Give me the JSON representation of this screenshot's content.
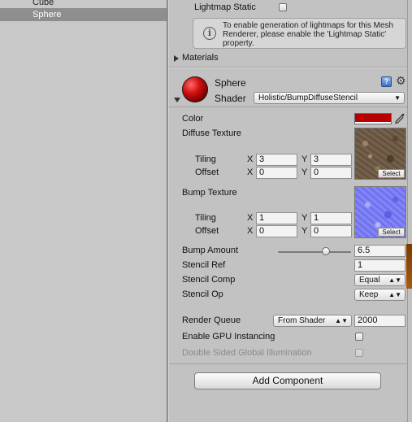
{
  "hierarchy": {
    "items": [
      {
        "label": "Cube",
        "selected": false
      },
      {
        "label": "Sphere",
        "selected": true
      }
    ]
  },
  "renderer": {
    "lightmap_static_label": "Lightmap Static",
    "lightmap_static_checked": false,
    "hint_text": "To enable generation of lightmaps for this Mesh Renderer, please enable the 'Lightmap Static' property.",
    "materials_label": "Materials"
  },
  "material": {
    "name": "Sphere",
    "shader_label": "Shader",
    "shader_value": "Holistic/BumpDiffuseStencil",
    "color_label": "Color",
    "color_value": "#b80000",
    "diffuse_texture_label": "Diffuse Texture",
    "bump_texture_label": "Bump Texture",
    "tiling_label": "Tiling",
    "offset_label": "Offset",
    "x_label": "X",
    "y_label": "Y",
    "diffuse": {
      "tiling_x": "3",
      "tiling_y": "3",
      "offset_x": "0",
      "offset_y": "0"
    },
    "bump": {
      "tiling_x": "1",
      "tiling_y": "1",
      "offset_x": "0",
      "offset_y": "0"
    },
    "select_label": "Select",
    "bump_amount_label": "Bump Amount",
    "bump_amount_value": "6.5",
    "bump_amount_slider_fraction": 0.65,
    "stencil_ref_label": "Stencil Ref",
    "stencil_ref_value": "1",
    "stencil_comp_label": "Stencil Comp",
    "stencil_comp_value": "Equal",
    "stencil_op_label": "Stencil Op",
    "stencil_op_value": "Keep",
    "render_queue_label": "Render Queue",
    "render_queue_mode": "From Shader",
    "render_queue_value": "2000",
    "gpu_instancing_label": "Enable GPU Instancing",
    "gpu_instancing_checked": false,
    "double_sided_gi_label": "Double Sided Global Illumination",
    "double_sided_gi_checked": false
  },
  "add_component_label": "Add Component",
  "icons": {
    "info": "info-icon",
    "help": "help-book-icon",
    "settings": "gear-icon",
    "eyedropper": "eyedropper-icon"
  }
}
